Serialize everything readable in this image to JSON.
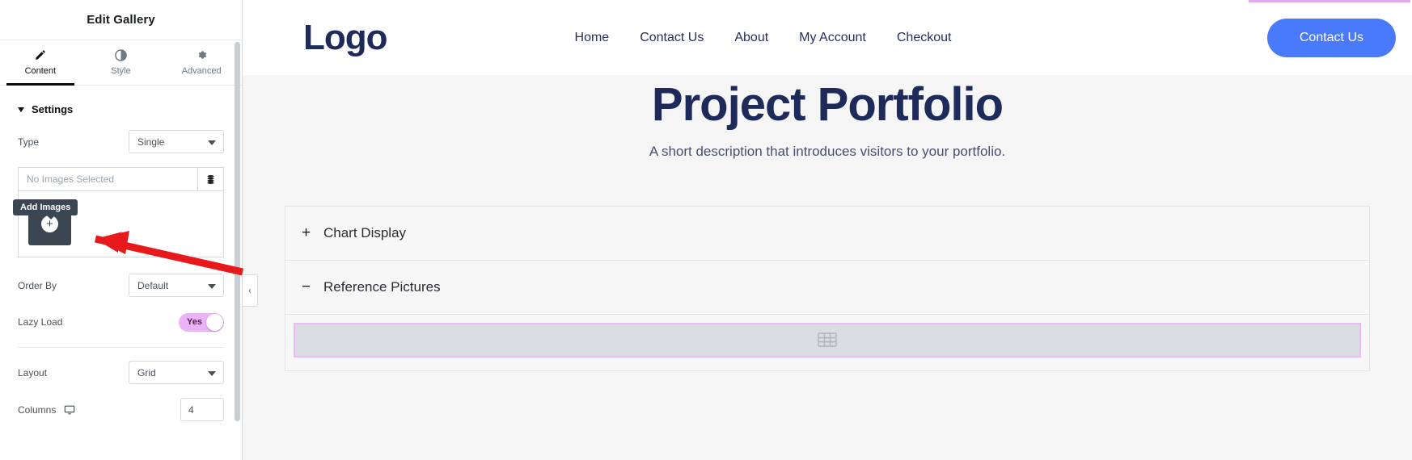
{
  "panel": {
    "title": "Edit Gallery",
    "tabs": [
      {
        "label": "Content",
        "icon": "pencil-icon",
        "active": true
      },
      {
        "label": "Style",
        "icon": "contrast-icon",
        "active": false
      },
      {
        "label": "Advanced",
        "icon": "gear-icon",
        "active": false
      }
    ],
    "section": {
      "label": "Settings",
      "expanded": true
    },
    "controls": {
      "type_label": "Type",
      "type_value": "Single",
      "gallery_placeholder": "No Images Selected",
      "gallery_list_icon": "stack-list-icon",
      "add_tile_icon": "plus-icon",
      "tooltip": "Add Images",
      "order_by_label": "Order By",
      "order_by_value": "Default",
      "lazy_load_label": "Lazy Load",
      "lazy_load_value": "Yes",
      "layout_label": "Layout",
      "layout_value": "Grid",
      "columns_label": "Columns",
      "columns_device_icon": "desktop-icon",
      "columns_value": "4"
    },
    "collapse_handle_icon": "chevron-left-icon",
    "accent_toggle_color": "#eab3f5"
  },
  "preview": {
    "header": {
      "logo": "Logo",
      "nav": [
        "Home",
        "Contact Us",
        "About",
        "My Account",
        "Checkout"
      ],
      "cta_label": "Contact Us",
      "cta_color": "#4a7afc"
    },
    "hero": {
      "title": "Project Portfolio",
      "subtitle": "A short description that introduces visitors to your portfolio."
    },
    "accordion": [
      {
        "label": "Chart Display",
        "sign": "+",
        "expanded": false
      },
      {
        "label": "Reference Pictures",
        "sign": "−",
        "expanded": true
      }
    ],
    "gallery_widget": {
      "icon": "gallery-grid-icon",
      "selected_outline_color": "#f0b6f7"
    }
  },
  "annotation": {
    "arrow_color": "#e8191b",
    "points_to": "add-images-tile"
  }
}
